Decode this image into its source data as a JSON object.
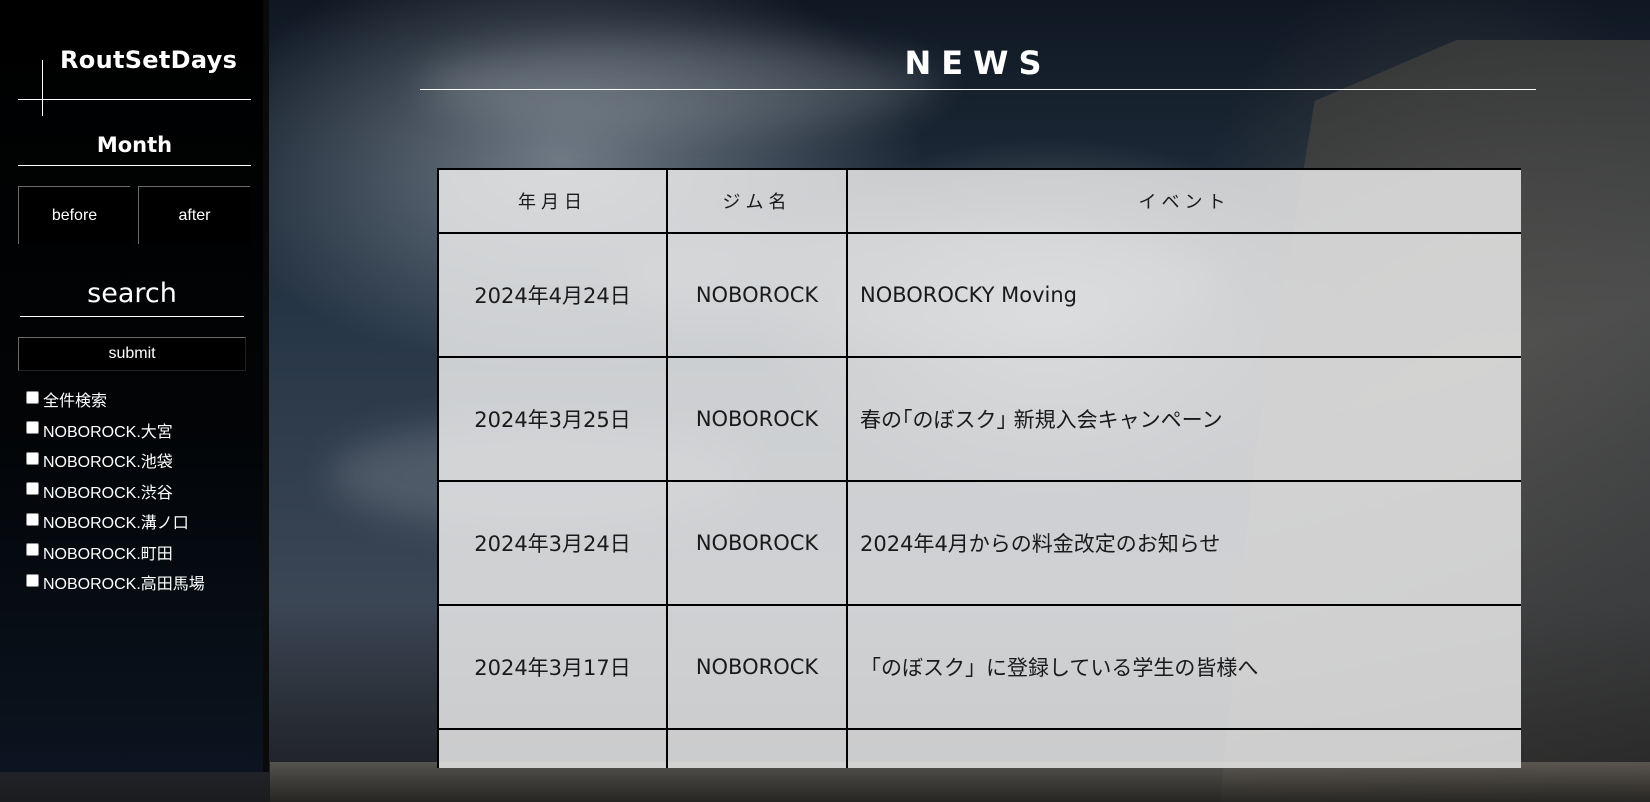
{
  "sidebar": {
    "brand": "RoutSetDays",
    "month_title": "Month",
    "before_label": "before",
    "after_label": "after",
    "search_title": "search",
    "submit_label": "submit",
    "filters": [
      "全件検索",
      "NOBOROCK.大宮",
      "NOBOROCK.池袋",
      "NOBOROCK.渋谷",
      "NOBOROCK.溝ノ口",
      "NOBOROCK.町田",
      "NOBOROCK.高田馬場"
    ]
  },
  "main": {
    "title": "NEWS",
    "table": {
      "headers": [
        "年月日",
        "ジム名",
        "イベント"
      ],
      "rows": [
        {
          "date": "2024年4月24日",
          "gym": "NOBOROCK",
          "event": "NOBOROCKY Moving"
        },
        {
          "date": "2024年3月25日",
          "gym": "NOBOROCK",
          "event": "春の｢のぼスク｣ 新規入会キャンペーン"
        },
        {
          "date": "2024年3月24日",
          "gym": "NOBOROCK",
          "event": "2024年4月からの料金改定のお知らせ"
        },
        {
          "date": "2024年3月17日",
          "gym": "NOBOROCK",
          "event": "「のぼスク」に登録している学生の皆様へ"
        }
      ]
    }
  }
}
